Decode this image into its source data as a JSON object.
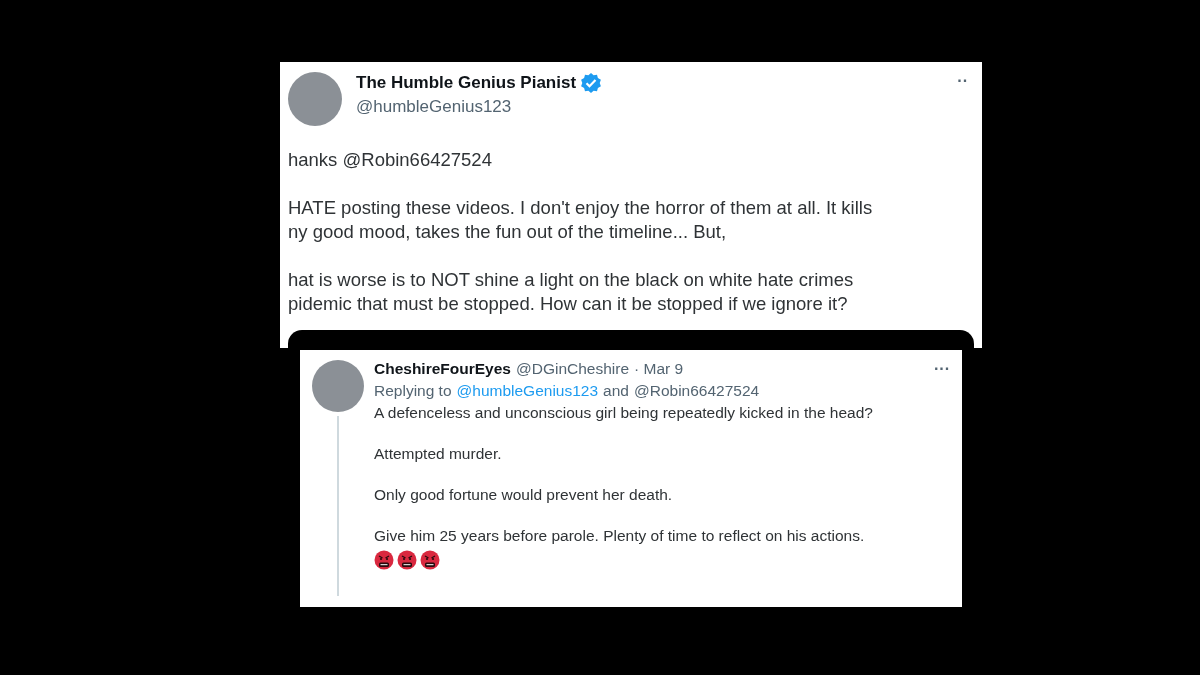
{
  "main_post": {
    "display_name": "The Humble Genius Pianist",
    "verified": true,
    "handle": "@humbleGenius123",
    "more": "··",
    "paragraphs": [
      {
        "lines": [
          "hanks @Robin66427524"
        ]
      },
      {
        "lines": [
          "HATE posting these videos. I don't enjoy the horror of them at all. It kills",
          "ny good mood, takes the fun out of the timeline... But,"
        ]
      },
      {
        "lines": [
          "hat is worse is to NOT shine a light on the black on white hate crimes",
          "pidemic that must be stopped. How can it be stopped if we ignore it?"
        ]
      }
    ]
  },
  "reply": {
    "display_name": "CheshireFourEyes",
    "handle": "@DGinCheshire",
    "date": "· Mar 9",
    "more": "···",
    "replying_to": {
      "prefix": "Replying to",
      "mentions": [
        "@humbleGenius123",
        "@Robin66427524"
      ],
      "joiner": "and"
    },
    "paragraphs": [
      "A defenceless and unconscious girl being repeatedly kicked in the head?",
      "Attempted murder.",
      "Only good fortune would prevent her death.",
      "Give him 25 years before parole. Plenty of time to reflect on his actions."
    ],
    "emojis": [
      {
        "kind": "cursing-face"
      },
      {
        "kind": "cursing-face"
      },
      {
        "kind": "cursing-face"
      }
    ]
  }
}
